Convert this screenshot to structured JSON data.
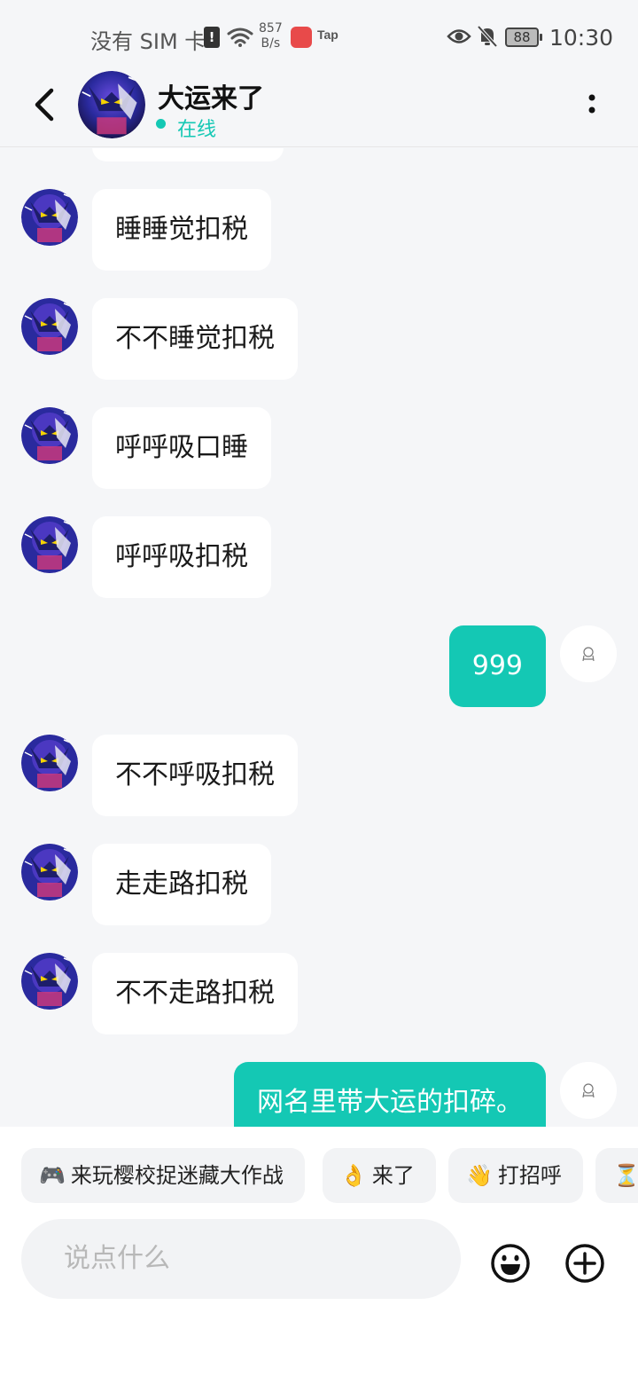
{
  "status_bar": {
    "carrier": "没有 SIM 卡",
    "sim_icon": "!",
    "speed_value": "857",
    "speed_unit": "B/s",
    "app_label": "Tap",
    "battery": "88",
    "time": "10:30",
    "icons": [
      "sim-alert-icon",
      "wifi-icon",
      "app-store-icon",
      "taptap-icon",
      "eye-icon",
      "bell-off-icon",
      "battery-icon"
    ]
  },
  "header": {
    "name": "大运来了",
    "status": "在线",
    "back_icon": "chevron-left-icon",
    "more_icon": "more-vertical-icon",
    "status_color": "#14c8b4"
  },
  "messages": [
    {
      "side": "in",
      "text": "睡睡觉扣税"
    },
    {
      "side": "in",
      "text": "不不睡觉扣税"
    },
    {
      "side": "in",
      "text": "呼呼吸口睡"
    },
    {
      "side": "in",
      "text": "呼呼吸扣税"
    },
    {
      "side": "out",
      "text": "999"
    },
    {
      "side": "in",
      "text": "不不呼吸扣税"
    },
    {
      "side": "in",
      "text": "走走路扣税"
    },
    {
      "side": "in",
      "text": "不不走路扣税"
    },
    {
      "side": "out",
      "text": "网名里带大运的扣碎。"
    }
  ],
  "quick_replies": [
    {
      "icon": "🎮",
      "label": "来玩樱校捉迷藏大作战"
    },
    {
      "icon": "👌",
      "label": "来了"
    },
    {
      "icon": "👋",
      "label": "打招呼"
    },
    {
      "icon": "⏳",
      "label": ""
    }
  ],
  "composer": {
    "placeholder": "说点什么",
    "emoji_icon": "smiley-icon",
    "plus_icon": "plus-circle-icon"
  },
  "colors": {
    "accent": "#14c8b4",
    "background": "#f5f6f8",
    "bubble_in": "#ffffff"
  }
}
